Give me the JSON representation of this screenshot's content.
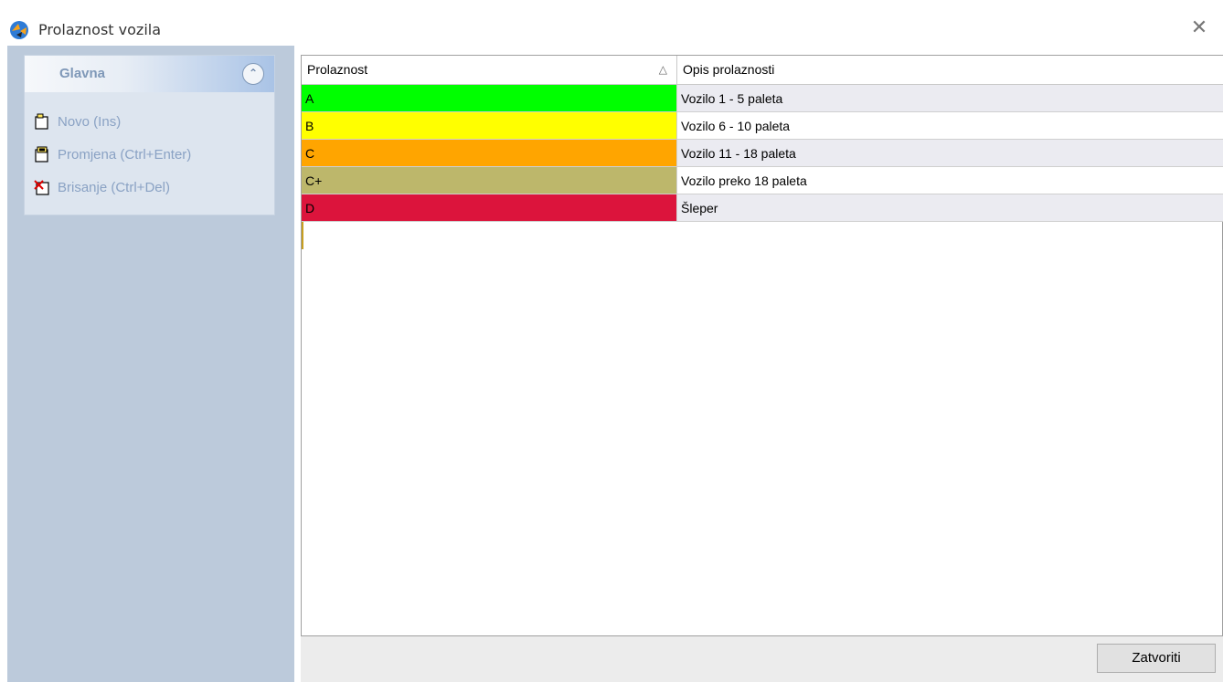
{
  "window": {
    "title": "Prolaznost vozila"
  },
  "sidebar": {
    "group_title": "Glavna",
    "actions": [
      {
        "label": "Novo (Ins)",
        "icon": "new-document-icon"
      },
      {
        "label": "Promjena (Ctrl+Enter)",
        "icon": "edit-document-icon"
      },
      {
        "label": "Brisanje (Ctrl+Del)",
        "icon": "delete-document-icon"
      }
    ]
  },
  "grid": {
    "columns": [
      "Prolaznost",
      "Opis prolaznosti"
    ],
    "rows": [
      {
        "code": "A",
        "desc": "Vozilo 1 - 5 paleta",
        "color": "#00ff00"
      },
      {
        "code": "B",
        "desc": "Vozilo 6 - 10 paleta",
        "color": "#ffff00"
      },
      {
        "code": "C",
        "desc": "Vozilo 11 - 18 paleta",
        "color": "#ffa500"
      },
      {
        "code": "C+",
        "desc": "Vozilo preko 18 paleta",
        "color": "#bdb76b"
      },
      {
        "code": "D",
        "desc": "Šleper",
        "color": "#dc143c"
      }
    ]
  },
  "footer": {
    "close_label": "Zatvoriti"
  },
  "colors": {
    "sidebar_bg": "#bccadb",
    "row_alt": "#ebebf1"
  }
}
